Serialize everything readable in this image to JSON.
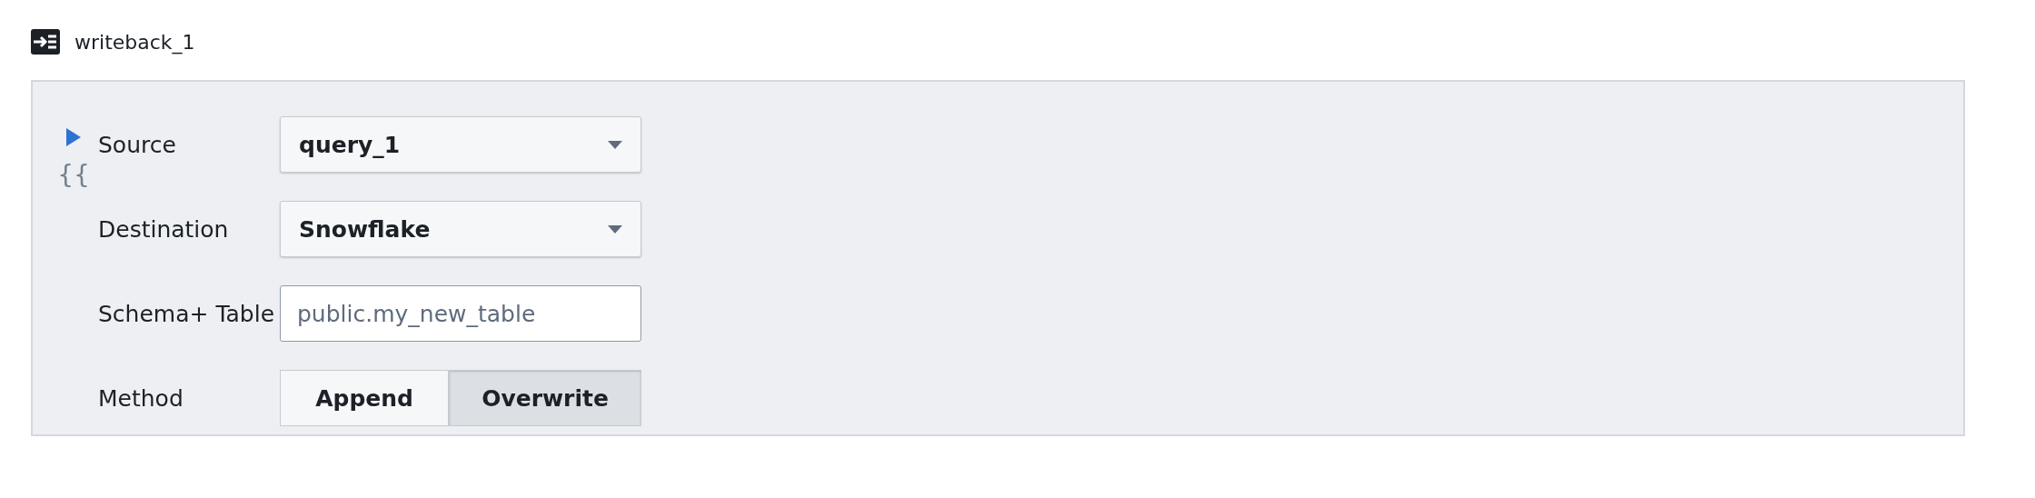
{
  "block": {
    "title": "writeback_1"
  },
  "gutter": {
    "template_mark": "{{"
  },
  "fields": [
    {
      "kind": "dropdown",
      "label": "Source",
      "value": "query_1"
    },
    {
      "kind": "dropdown",
      "label": "Destination",
      "value": "Snowflake"
    },
    {
      "kind": "text",
      "label": "Schema+ Table",
      "placeholder": "public.my_new_table"
    },
    {
      "kind": "segmented",
      "label": "Method",
      "options": [
        {
          "label": "Append",
          "selected": false
        },
        {
          "label": "Overwrite",
          "selected": true
        }
      ]
    }
  ]
}
